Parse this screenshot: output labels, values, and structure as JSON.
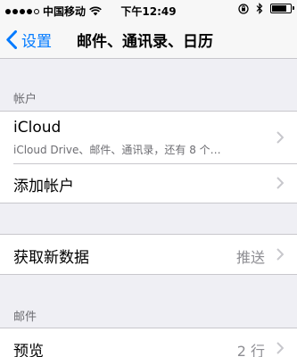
{
  "status_bar": {
    "carrier": "中国移动",
    "time": "下午12:49",
    "battery_level": 0.85
  },
  "nav": {
    "back_label": "设置",
    "title": "邮件、通讯录、日历"
  },
  "accounts": {
    "header": "帐户",
    "items": [
      {
        "title": "iCloud",
        "subtitle": "iCloud Drive、邮件、通讯录，还有 8 个…"
      },
      {
        "title": "添加帐户"
      }
    ]
  },
  "fetch": {
    "title": "获取新数据",
    "value": "推送"
  },
  "mail": {
    "header": "邮件",
    "items": [
      {
        "title": "预览",
        "value": "2 行"
      }
    ]
  },
  "icons": [
    "signal-dots-icon",
    "wifi-icon",
    "lock-rotation-icon",
    "bluetooth-icon",
    "battery-icon",
    "back-chevron-icon",
    "chevron-right-icon"
  ],
  "colors": {
    "accent": "#007aff",
    "background": "#efeff4",
    "separator": "#c8c7cc",
    "secondary_text": "#8e8e93"
  }
}
